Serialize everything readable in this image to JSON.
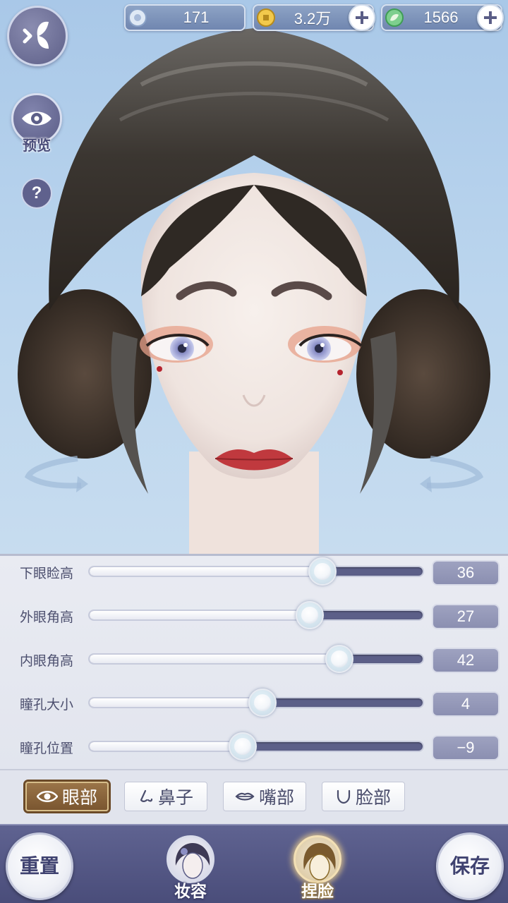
{
  "currencies": {
    "jade": {
      "value": "171",
      "icon": "jade-disc-icon"
    },
    "coin": {
      "value": "3.2万",
      "icon": "copper-coin-icon"
    },
    "leaf": {
      "value": "1566",
      "icon": "green-leaf-icon"
    }
  },
  "left_controls": {
    "preview_label": "预览",
    "help_label": "?"
  },
  "sliders": [
    {
      "label": "下眼睑高",
      "value": "36",
      "fraction": 0.7
    },
    {
      "label": "外眼角高",
      "value": "27",
      "fraction": 0.66
    },
    {
      "label": "内眼角高",
      "value": "42",
      "fraction": 0.75
    },
    {
      "label": "瞳孔大小",
      "value": "4",
      "fraction": 0.52
    },
    {
      "label": "瞳孔位置",
      "value": "−9",
      "fraction": 0.46
    }
  ],
  "tabs": [
    {
      "label": "眼部",
      "icon": "eye-icon",
      "active": true
    },
    {
      "label": "鼻子",
      "icon": "nose-icon",
      "active": false
    },
    {
      "label": "嘴部",
      "icon": "mouth-icon",
      "active": false
    },
    {
      "label": "脸部",
      "icon": "face-icon",
      "active": false
    }
  ],
  "bottom_bar": {
    "reset_label": "重置",
    "save_label": "保存",
    "makeup_label": "妆容",
    "face_label": "捏脸",
    "active_mode": "捏脸"
  },
  "colors": {
    "accent_purple": "#5c5f88",
    "active_tab_brown": "#8a6438",
    "bottom_bar": "#5f6391"
  }
}
